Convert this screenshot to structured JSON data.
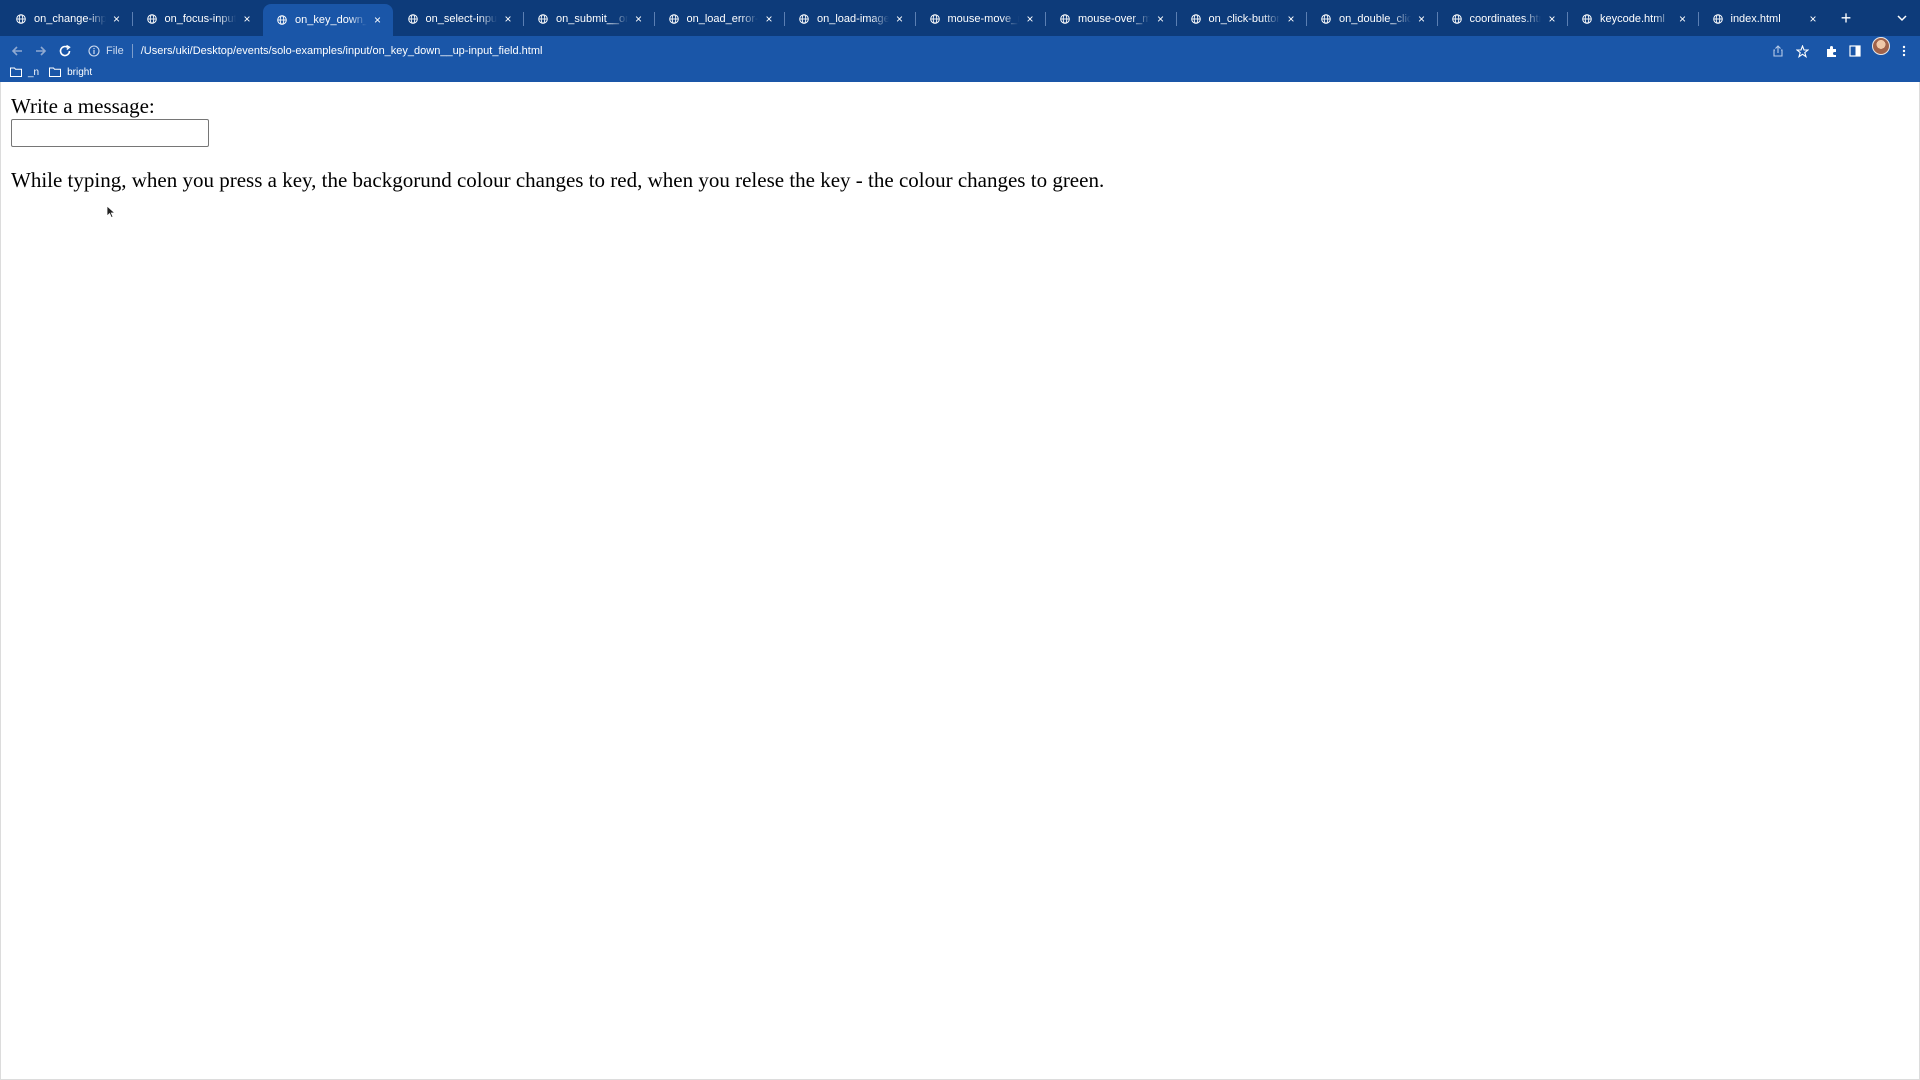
{
  "browser": {
    "tabs": [
      {
        "label": "on_change-input_field.html",
        "active": false
      },
      {
        "label": "on_focus-input_field.html",
        "active": false
      },
      {
        "label": "on_key_down__up-input_field.html",
        "active": true
      },
      {
        "label": "on_select-input_field.html",
        "active": false
      },
      {
        "label": "on_submit__on_reset.html",
        "active": false
      },
      {
        "label": "on_load_error-image.html",
        "active": false
      },
      {
        "label": "on_load-image.html",
        "active": false
      },
      {
        "label": "mouse-move_mouse.html",
        "active": false
      },
      {
        "label": "mouse-over_mouse.html",
        "active": false
      },
      {
        "label": "on_click-button.html",
        "active": false
      },
      {
        "label": "on_double_click-button.html",
        "active": false
      },
      {
        "label": "coordinates.html",
        "active": false
      },
      {
        "label": "keycode.html",
        "active": false
      },
      {
        "label": "index.html",
        "active": false
      }
    ],
    "omnibox": {
      "scheme": "File",
      "url": "/Users/uki/Desktop/events/solo-examples/input/on_key_down__up-input_field.html"
    },
    "bookmarks": [
      {
        "label": "_n"
      },
      {
        "label": "bright"
      }
    ],
    "colors": {
      "tabstrip": "#0d3b7a",
      "toolbar": "#1a56a8",
      "text": "#ffffff"
    }
  },
  "page": {
    "label": "Write a message:",
    "input_value": "",
    "instructions": "While typing, when you press a key, the backgorund colour changes to red, when you relese the key - the colour changes to green."
  }
}
